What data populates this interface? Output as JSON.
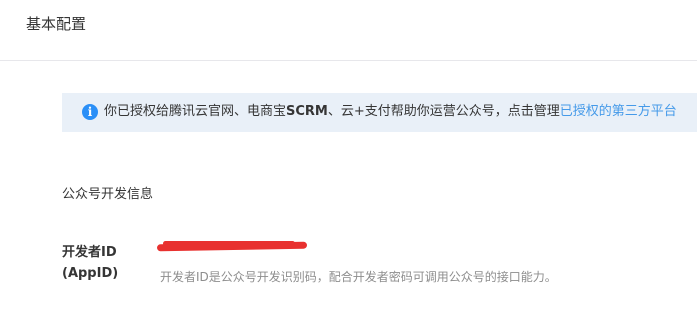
{
  "header": {
    "title": "基本配置"
  },
  "notice": {
    "icon": "info-icon",
    "text_before": "你已授权给腾讯云官网、电商宝",
    "text_bold": "SCRM",
    "text_middle": "、云+支付帮助你运营公众号，点击管理",
    "link_text": "已授权的第三方平台"
  },
  "developer_info": {
    "section_title": "公众号开发信息",
    "appid": {
      "label_line1": "开发者ID",
      "label_line2": "(AppID)",
      "value_redacted": true,
      "help": "开发者ID是公众号开发识别码，配合开发者密码可调用公众号的接口能力。"
    }
  },
  "colors": {
    "notice_bg": "#e9f0f8",
    "info_icon": "#2a8ff7",
    "link": "#459ae9",
    "redaction": "#e8312f",
    "help_text": "#8d8d8d"
  }
}
